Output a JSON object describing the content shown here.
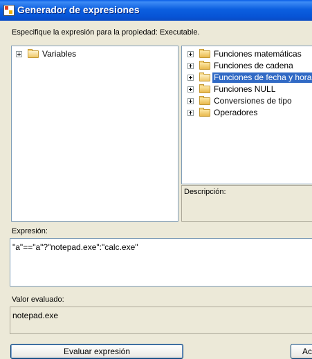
{
  "window": {
    "title": "Generador de expresiones"
  },
  "instruction": "Especifique la expresión para la propiedad: Executable.",
  "variables_tree": {
    "items": [
      {
        "label": "Variables"
      }
    ]
  },
  "functions_tree": {
    "items": [
      {
        "label": "Funciones matemáticas"
      },
      {
        "label": "Funciones de cadena"
      },
      {
        "label": "Funciones de fecha y hora",
        "selected": true
      },
      {
        "label": "Funciones NULL"
      },
      {
        "label": "Conversiones de tipo"
      },
      {
        "label": "Operadores"
      }
    ]
  },
  "description": {
    "label": "Descripción:"
  },
  "expression": {
    "label": "Expresión:",
    "value": "\"a\"==\"a\"?\"notepad.exe\":\"calc.exe\""
  },
  "evaluated": {
    "label": "Valor evaluado:",
    "value": "notepad.exe"
  },
  "buttons": {
    "evaluate": "Evaluar expresión",
    "accept": "Ac"
  },
  "colors": {
    "title_bar": "#0A5FE6",
    "window_bg": "#ECE9D8",
    "selection": "#316AC5",
    "border": "#7F9DB9"
  }
}
